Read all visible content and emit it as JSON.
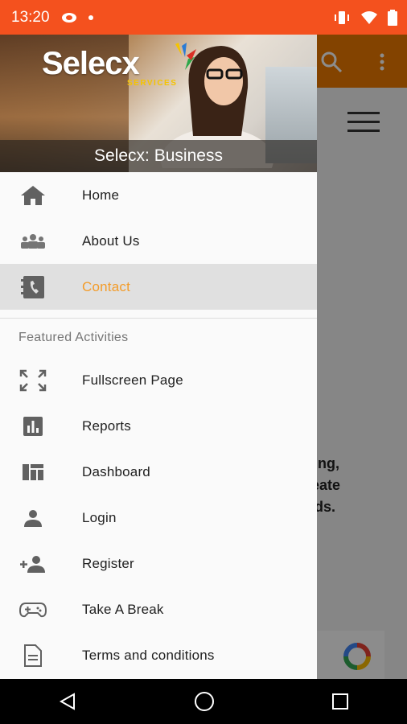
{
  "status_bar": {
    "time": "13:20",
    "left_icons": [
      "cast-icon",
      "dot-icon"
    ],
    "right_icons": [
      "vibrate-icon",
      "wifi-icon",
      "battery-icon"
    ]
  },
  "background": {
    "text_lines": [
      "king,",
      "reate",
      "nds."
    ]
  },
  "drawer": {
    "header": {
      "logo_text": "Selecx",
      "logo_sub": "SERVICES",
      "title": "Selecx: Business"
    },
    "main_items": [
      {
        "label": "Home",
        "icon": "home-icon"
      },
      {
        "label": "About Us",
        "icon": "group-icon"
      },
      {
        "label": "Contact",
        "icon": "contact-book-icon",
        "selected": true
      }
    ],
    "section_title": "Featured Activities",
    "featured_items": [
      {
        "label": "Fullscreen Page",
        "icon": "fullscreen-icon"
      },
      {
        "label": "Reports",
        "icon": "bar-chart-icon"
      },
      {
        "label": "Dashboard",
        "icon": "dashboard-icon"
      },
      {
        "label": "Login",
        "icon": "person-icon"
      },
      {
        "label": "Register",
        "icon": "person-add-icon"
      },
      {
        "label": "Take A Break",
        "icon": "gamepad-icon"
      },
      {
        "label": "Terms and conditions",
        "icon": "document-icon"
      }
    ]
  },
  "colors": {
    "status_bar": "#f4511e",
    "toolbar": "#ef7b00",
    "accent": "#f39c2a",
    "selected_bg": "#e0e0e0"
  }
}
